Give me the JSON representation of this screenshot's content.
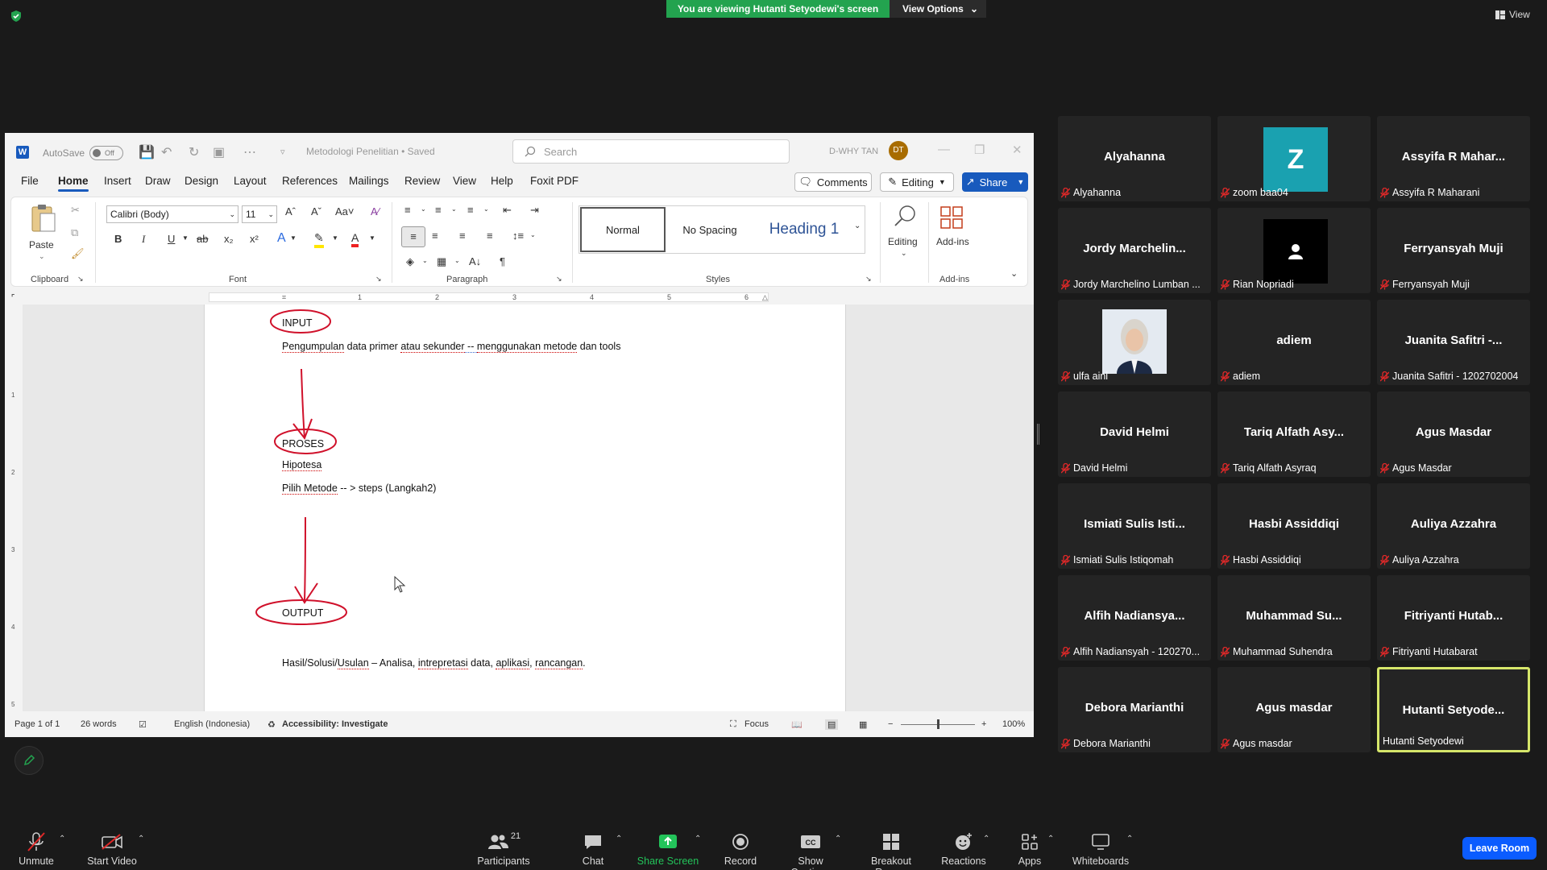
{
  "zoom": {
    "banner": "You are viewing Hutanti Setyodewi's screen",
    "view_options": "View Options",
    "view": "View"
  },
  "word": {
    "autosave_label": "AutoSave",
    "autosave_state": "Off",
    "doc_title": "Metodologi Penelitian • Saved",
    "search_placeholder": "Search",
    "user_name": "D-WHY TAN",
    "user_initials": "DT",
    "menu": [
      "File",
      "Home",
      "Insert",
      "Draw",
      "Design",
      "Layout",
      "References",
      "Mailings",
      "Review",
      "View",
      "Help",
      "Foxit PDF"
    ],
    "comments": "Comments",
    "editing": "Editing",
    "share": "Share",
    "ribbon": {
      "paste": "Paste",
      "clipboard": "Clipboard",
      "font_name": "Calibri (Body)",
      "font_size": "11",
      "font": "Font",
      "paragraph": "Paragraph",
      "styles": "Styles",
      "style_items": [
        "Normal",
        "No Spacing",
        "Heading 1"
      ],
      "editing_btn": "Editing",
      "addins_btn": "Add-ins",
      "addins_grp": "Add-ins"
    },
    "ruler_numbers": [
      "1",
      "2",
      "3",
      "4",
      "5",
      "6"
    ],
    "vruler_numbers": [
      "1",
      "2",
      "3",
      "4",
      "5"
    ],
    "doc": {
      "input": "INPUT",
      "line1_a": "Pengumpulan",
      "line1_b": " data primer ",
      "line1_c": "atau sekunder",
      "line1_d": "  -- ",
      "line1_e": "menggunakan metode",
      "line1_f": " dan tools",
      "proses": "PROSES",
      "hipotesa": "Hipotesa",
      "pilih_a": "Pilih Metode",
      "pilih_b": "  -- > steps (Langkah2)",
      "output": "OUTPUT",
      "hasil_a": "Hasil/Solusi/",
      "hasil_b": "Usulan",
      "hasil_c": " – Analisa, ",
      "hasil_d": "intrepretasi",
      "hasil_e": " data, ",
      "hasil_f": "aplikasi",
      "hasil_g": ", ",
      "hasil_h": "rancangan",
      "hasil_i": "."
    },
    "status": {
      "page": "Page 1 of 1",
      "words": "26 words",
      "language": "English (Indonesia)",
      "accessibility": "Accessibility: Investigate",
      "focus": "Focus",
      "zoom": "100%",
      "zoom_level": 0.5
    }
  },
  "participants": [
    {
      "name": "Alyahanna",
      "label": "Alyahanna",
      "type": "text",
      "muted": true
    },
    {
      "name": "",
      "label": "zoom baa04",
      "type": "letter",
      "letter": "Z",
      "muted": true
    },
    {
      "name": "Assyifa R Mahar...",
      "label": "Assyifa R Maharani",
      "type": "text",
      "muted": true
    },
    {
      "name": "Jordy  Marchelin...",
      "label": "Jordy Marchelino Lumban ...",
      "type": "text",
      "muted": true
    },
    {
      "name": "",
      "label": "Rian Nopriadi",
      "type": "avatar",
      "muted": true
    },
    {
      "name": "Ferryansyah Muji",
      "label": "Ferryansyah Muji",
      "type": "text",
      "muted": true
    },
    {
      "name": "",
      "label": "ulfa aini",
      "type": "photo",
      "muted": true
    },
    {
      "name": "adiem",
      "label": "adiem",
      "type": "text",
      "muted": true
    },
    {
      "name": "Juanita  Safitri  -...",
      "label": "Juanita Safitri - 1202702004",
      "type": "text",
      "muted": true
    },
    {
      "name": "David Helmi",
      "label": "David Helmi",
      "type": "text",
      "muted": true
    },
    {
      "name": "Tariq Alfath Asy...",
      "label": "Tariq Alfath Asyraq",
      "type": "text",
      "muted": true
    },
    {
      "name": "Agus Masdar",
      "label": "Agus Masdar",
      "type": "text",
      "muted": true
    },
    {
      "name": "Ismiati  Sulis  Isti...",
      "label": "Ismiati Sulis Istiqomah",
      "type": "text",
      "muted": true
    },
    {
      "name": "Hasbi Assiddiqi",
      "label": "Hasbi Assiddiqi",
      "type": "text",
      "muted": true
    },
    {
      "name": "Auliya Azzahra",
      "label": "Auliya Azzahra",
      "type": "text",
      "muted": true
    },
    {
      "name": "Alfih  Nadiansya...",
      "label": "Alfih Nadiansyah - 120270...",
      "type": "text",
      "muted": true
    },
    {
      "name": "Muhammad  Su...",
      "label": "Muhammad Suhendra",
      "type": "text",
      "muted": true
    },
    {
      "name": "Fitriyanti  Hutab...",
      "label": "Fitriyanti Hutabarat",
      "type": "text",
      "muted": true
    },
    {
      "name": "Debora Marianthi",
      "label": "Debora Marianthi",
      "type": "text",
      "muted": true
    },
    {
      "name": "Agus masdar",
      "label": "Agus masdar",
      "type": "text",
      "muted": true
    },
    {
      "name": "Hutanti  Setyode...",
      "label": "Hutanti Setyodewi",
      "type": "text",
      "muted": false,
      "active": true
    }
  ],
  "toolbar": {
    "unmute": "Unmute",
    "start_video": "Start Video",
    "participants": "Participants",
    "participants_count": "21",
    "chat": "Chat",
    "share_screen": "Share Screen",
    "record": "Record",
    "show_captions": "Show Captions",
    "breakout_rooms": "Breakout Rooms",
    "reactions": "Reactions",
    "apps": "Apps",
    "whiteboards": "Whiteboards",
    "leave": "Leave Room"
  },
  "colors": {
    "zoom_green": "#23a34f",
    "word_blue": "#185abd",
    "ink_red": "#d0112b",
    "active_speaker": "#d6e66a",
    "leave_blue": "#0b5cff"
  }
}
